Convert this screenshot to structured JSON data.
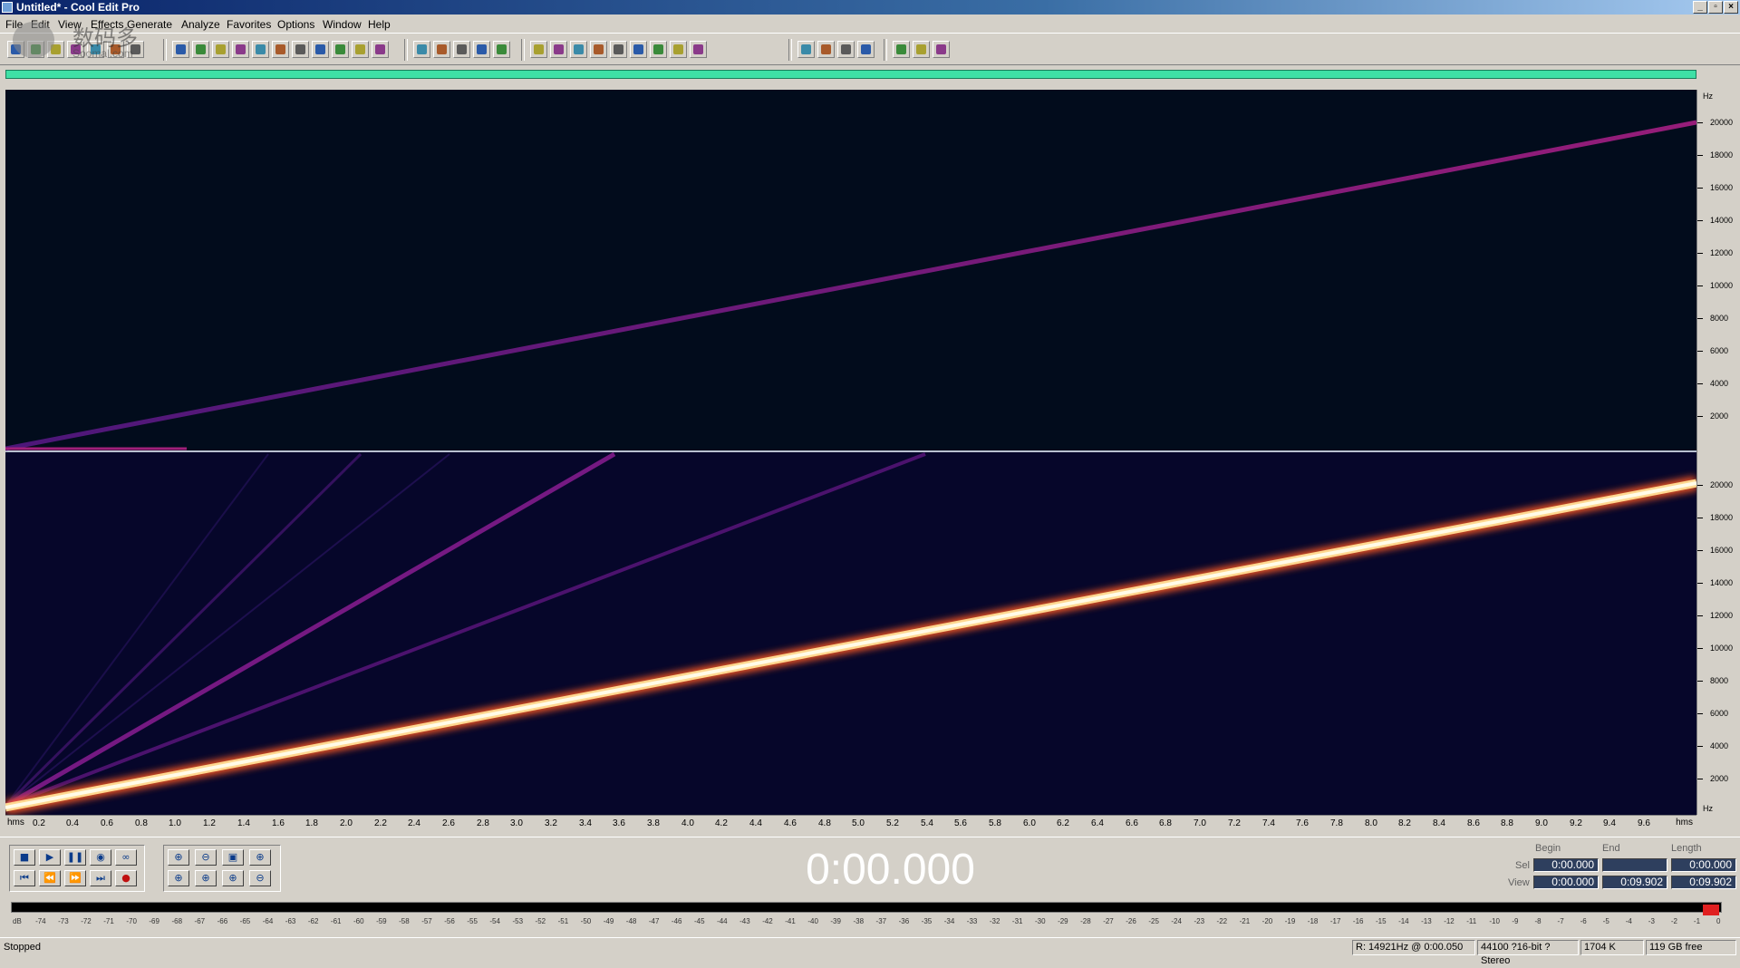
{
  "window": {
    "title": "Untitled* - Cool Edit Pro",
    "min_glyph": "_",
    "max_glyph": "▫",
    "close_glyph": "×"
  },
  "watermark": {
    "line1": "数码多",
    "line2": "Soomal.com"
  },
  "menu": {
    "items": [
      {
        "label": "File"
      },
      {
        "label": "Edit"
      },
      {
        "label": "View"
      },
      {
        "label": "Effects"
      },
      {
        "label": "Generate"
      },
      {
        "label": "Analyze"
      },
      {
        "label": "Favorites"
      },
      {
        "label": "Options"
      },
      {
        "label": "Window"
      },
      {
        "label": "Help"
      }
    ]
  },
  "toolbar": {
    "icons": [
      "waveform-view-icon",
      "multitrack-view-icon",
      "new-file-icon",
      "open-file-icon",
      "save-file-icon",
      "undo-icon",
      "redo-icon",
      "repeat-icon",
      "copy-icon",
      "cut-icon",
      "paste-icon",
      "paste-new-icon",
      "mix-paste-icon",
      "trim-icon",
      "delete-icon",
      "noise-reduction-icon",
      "envelope-icon",
      "fade-icon",
      "normalize-icon",
      "stretch-icon",
      "waveform-display-icon",
      "spectral-display-icon",
      "spectral-plot-icon",
      "play-icon",
      "zoom-icon",
      "frequency-icon",
      "graph-icon",
      "meter-icon",
      "filter-icon",
      "amplify-icon",
      "reverb-icon",
      "help-icon",
      "cd-icon",
      "cd-write-icon",
      "cd-track-icon",
      "cd-burn-icon",
      "tools-icon",
      "script-icon",
      "settings-icon"
    ]
  },
  "editor": {
    "spectrogram": {
      "top_channel": {
        "sweep_hz_start": 0,
        "sweep_hz_end": 20000
      },
      "bottom_channel": {
        "sweep_hz_start": 0,
        "sweep_hz_end": 20000,
        "harmonics": true
      }
    },
    "hz_unit": "Hz",
    "hz_ticks_top": [
      "20000",
      "18000",
      "16000",
      "14000",
      "12000",
      "10000",
      "8000",
      "6000",
      "4000",
      "2000"
    ],
    "hz_ticks_bottom": [
      "20000",
      "18000",
      "16000",
      "14000",
      "12000",
      "10000",
      "8000",
      "6000",
      "4000",
      "2000"
    ],
    "time_unit": "hms",
    "time_ticks": [
      "0.2",
      "0.4",
      "0.6",
      "0.8",
      "1.0",
      "1.2",
      "1.4",
      "1.6",
      "1.8",
      "2.0",
      "2.2",
      "2.4",
      "2.6",
      "2.8",
      "3.0",
      "3.2",
      "3.4",
      "3.6",
      "3.8",
      "4.0",
      "4.2",
      "4.4",
      "4.6",
      "4.8",
      "5.0",
      "5.2",
      "5.4",
      "5.6",
      "5.8",
      "6.0",
      "6.2",
      "6.4",
      "6.6",
      "6.8",
      "7.0",
      "7.2",
      "7.4",
      "7.6",
      "7.8",
      "8.0",
      "8.2",
      "8.4",
      "8.6",
      "8.8",
      "9.0",
      "9.2",
      "9.4",
      "9.6"
    ]
  },
  "transport": {
    "row1": [
      {
        "name": "stop-button",
        "glyph": "■"
      },
      {
        "name": "play-button",
        "glyph": "▶"
      },
      {
        "name": "pause-button",
        "glyph": "❚❚"
      },
      {
        "name": "play-to-end-button",
        "glyph": "◉"
      },
      {
        "name": "loop-button",
        "glyph": "∞"
      }
    ],
    "row2": [
      {
        "name": "go-to-start-button",
        "glyph": "⏮"
      },
      {
        "name": "rewind-button",
        "glyph": "⏪"
      },
      {
        "name": "fast-forward-button",
        "glyph": "⏩"
      },
      {
        "name": "go-to-end-button",
        "glyph": "⏭"
      },
      {
        "name": "record-button",
        "glyph": "●"
      }
    ],
    "zoom_row1": [
      {
        "name": "zoom-in-button",
        "glyph": "⊕"
      },
      {
        "name": "zoom-out-button",
        "glyph": "⊖"
      },
      {
        "name": "zoom-full-button",
        "glyph": "▣"
      },
      {
        "name": "zoom-in-vertical-button",
        "glyph": "⊕"
      }
    ],
    "zoom_row2": [
      {
        "name": "zoom-to-left-button",
        "glyph": "⊕"
      },
      {
        "name": "zoom-to-right-button",
        "glyph": "⊕"
      },
      {
        "name": "zoom-to-selection-button",
        "glyph": "⊕"
      },
      {
        "name": "zoom-out-vertical-button",
        "glyph": "⊖"
      }
    ]
  },
  "time_display": "0:00.000",
  "selection_view": {
    "headers": {
      "begin": "Begin",
      "end": "End",
      "length": "Length"
    },
    "sel": {
      "label": "Sel",
      "begin": "0:00.000",
      "end": "",
      "length": "0:00.000"
    },
    "view": {
      "label": "View",
      "begin": "0:00.000",
      "end": "0:09.902",
      "length": "0:09.902"
    }
  },
  "level_meter": {
    "ticks": [
      "dB",
      "-74",
      "-73",
      "-72",
      "-71",
      "-70",
      "-69",
      "-68",
      "-67",
      "-66",
      "-65",
      "-64",
      "-63",
      "-62",
      "-61",
      "-60",
      "-59",
      "-58",
      "-57",
      "-56",
      "-55",
      "-54",
      "-53",
      "-52",
      "-51",
      "-50",
      "-49",
      "-48",
      "-47",
      "-46",
      "-45",
      "-44",
      "-43",
      "-42",
      "-41",
      "-40",
      "-39",
      "-38",
      "-37",
      "-36",
      "-35",
      "-34",
      "-33",
      "-32",
      "-31",
      "-30",
      "-29",
      "-28",
      "-27",
      "-26",
      "-25",
      "-24",
      "-23",
      "-22",
      "-21",
      "-20",
      "-19",
      "-18",
      "-17",
      "-16",
      "-15",
      "-14",
      "-13",
      "-12",
      "-11",
      "-10",
      "-9",
      "-8",
      "-7",
      "-6",
      "-5",
      "-4",
      "-3",
      "-2",
      "-1",
      "0"
    ],
    "clip_color": "#e02020"
  },
  "status": {
    "state": "Stopped",
    "cursor": "R: 14921Hz @   0:00.050",
    "format": "44100 ?16-bit ?Stereo",
    "size": "1704 K",
    "free": "119 GB free"
  },
  "colors": {
    "spectrogram_bg": "#020818",
    "sweep_top": "#8a1a8a",
    "sweep_bottom_core": "#fff6d0",
    "sweep_bottom_glow": "#ff6a30",
    "harmonic": "#8a1a9a",
    "overview": "#3fe0a6"
  }
}
